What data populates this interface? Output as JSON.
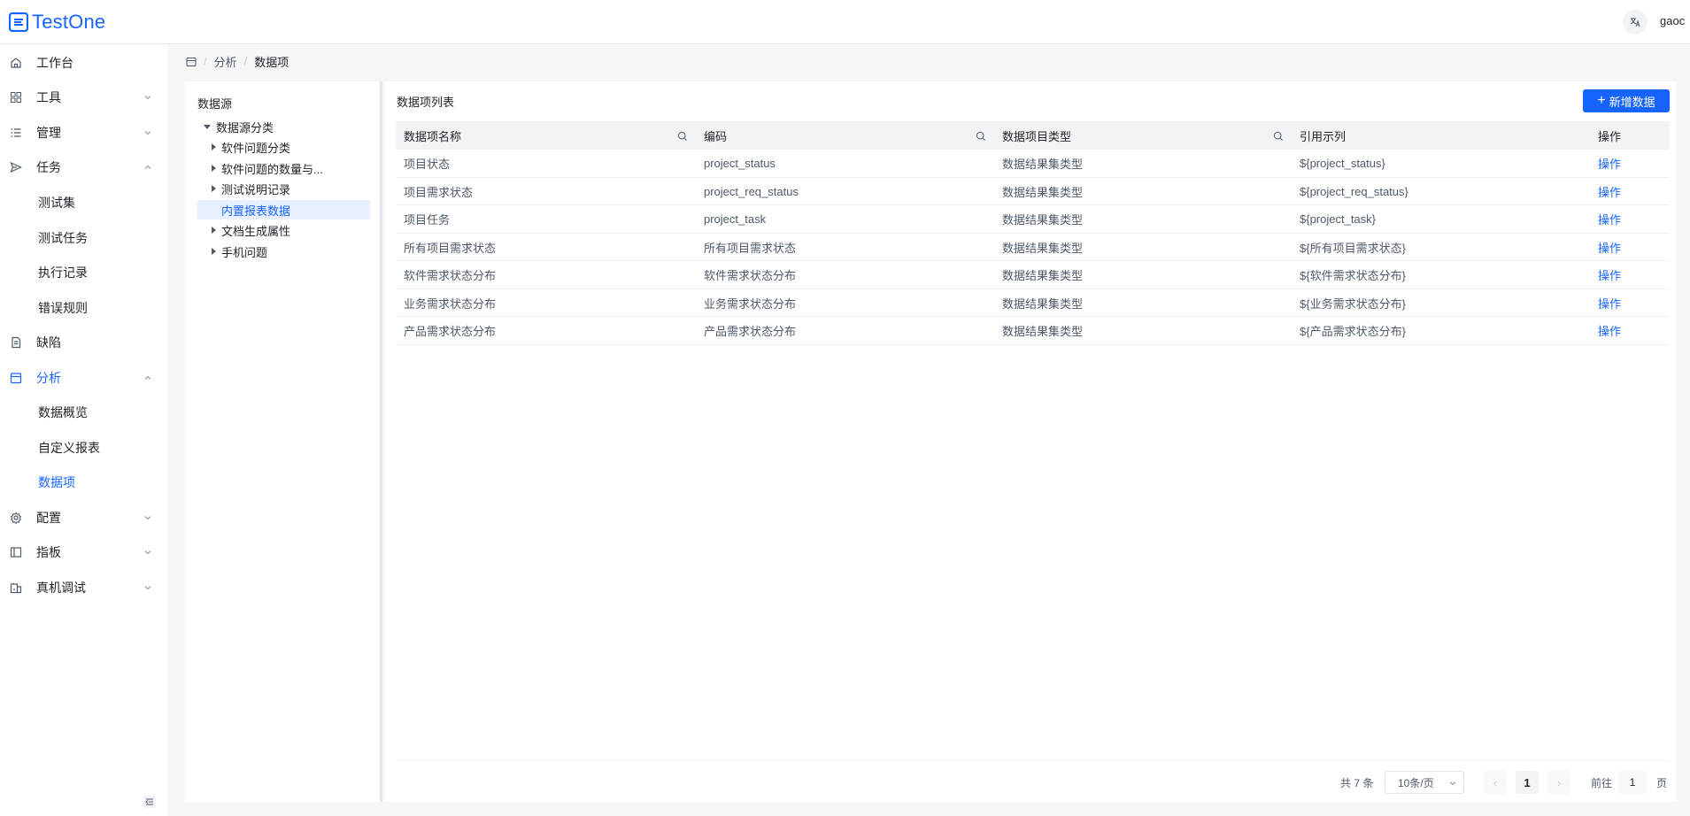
{
  "app": {
    "name": "TestOne",
    "lang_icon": "translate-icon",
    "user": "gaoc"
  },
  "colors": {
    "accent": "#1664ff",
    "selected_bg": "#e8f0ff"
  },
  "sidebar": {
    "items": [
      {
        "label": "工作台",
        "icon": "home-icon"
      },
      {
        "label": "工具",
        "icon": "grid-icon"
      },
      {
        "label": "管理",
        "icon": "list-icon"
      },
      {
        "label": "任务",
        "icon": "send-icon"
      },
      {
        "label": "缺陷",
        "icon": "document-icon"
      },
      {
        "label": "分析",
        "icon": "calendar-icon"
      },
      {
        "label": "配置",
        "icon": "gear-icon"
      },
      {
        "label": "指板",
        "icon": "layout-icon"
      },
      {
        "label": "真机调试",
        "icon": "device-icon"
      }
    ],
    "task_children": [
      "测试集",
      "测试任务",
      "执行记录",
      "错误规则"
    ],
    "analysis_children": [
      "数据概览",
      "自定义报表",
      "数据项"
    ]
  },
  "breadcrumb": {
    "level1": "分析",
    "current": "数据项"
  },
  "tree": {
    "title": "数据源",
    "root": "数据源分类",
    "nodes": [
      "软件问题分类",
      "软件问题的数量与...",
      "测试说明记录",
      "内置报表数据",
      "文档生成属性",
      "手机问题"
    ]
  },
  "main": {
    "title": "数据项列表",
    "add_button": "新增数据"
  },
  "table": {
    "headers": [
      "数据项名称",
      "编码",
      "数据项目类型",
      "引用示列",
      "操作"
    ],
    "rows": [
      [
        "项目状态",
        "project_status",
        "数据结果集类型",
        "${project_status}",
        "操作"
      ],
      [
        "项目需求状态",
        "project_req_status",
        "数据结果集类型",
        "${project_req_status}",
        "操作"
      ],
      [
        "项目任务",
        "project_task",
        "数据结果集类型",
        "${project_task}",
        "操作"
      ],
      [
        "所有项目需求状态",
        "所有项目需求状态",
        "数据结果集类型",
        "${所有项目需求状态}",
        "操作"
      ],
      [
        "软件需求状态分布",
        "软件需求状态分布",
        "数据结果集类型",
        "${软件需求状态分布}",
        "操作"
      ],
      [
        "业务需求状态分布",
        "业务需求状态分布",
        "数据结果集类型",
        "${业务需求状态分布}",
        "操作"
      ],
      [
        "产品需求状态分布",
        "产品需求状态分布",
        "数据结果集类型",
        "${产品需求状态分布}",
        "操作"
      ]
    ]
  },
  "pagination": {
    "total": "共 7 条",
    "page_size": "10条/页",
    "prev": "‹",
    "current_page": "1",
    "next": "›",
    "goto_label": "前往",
    "goto_value": "1",
    "goto_suffix": "页"
  }
}
